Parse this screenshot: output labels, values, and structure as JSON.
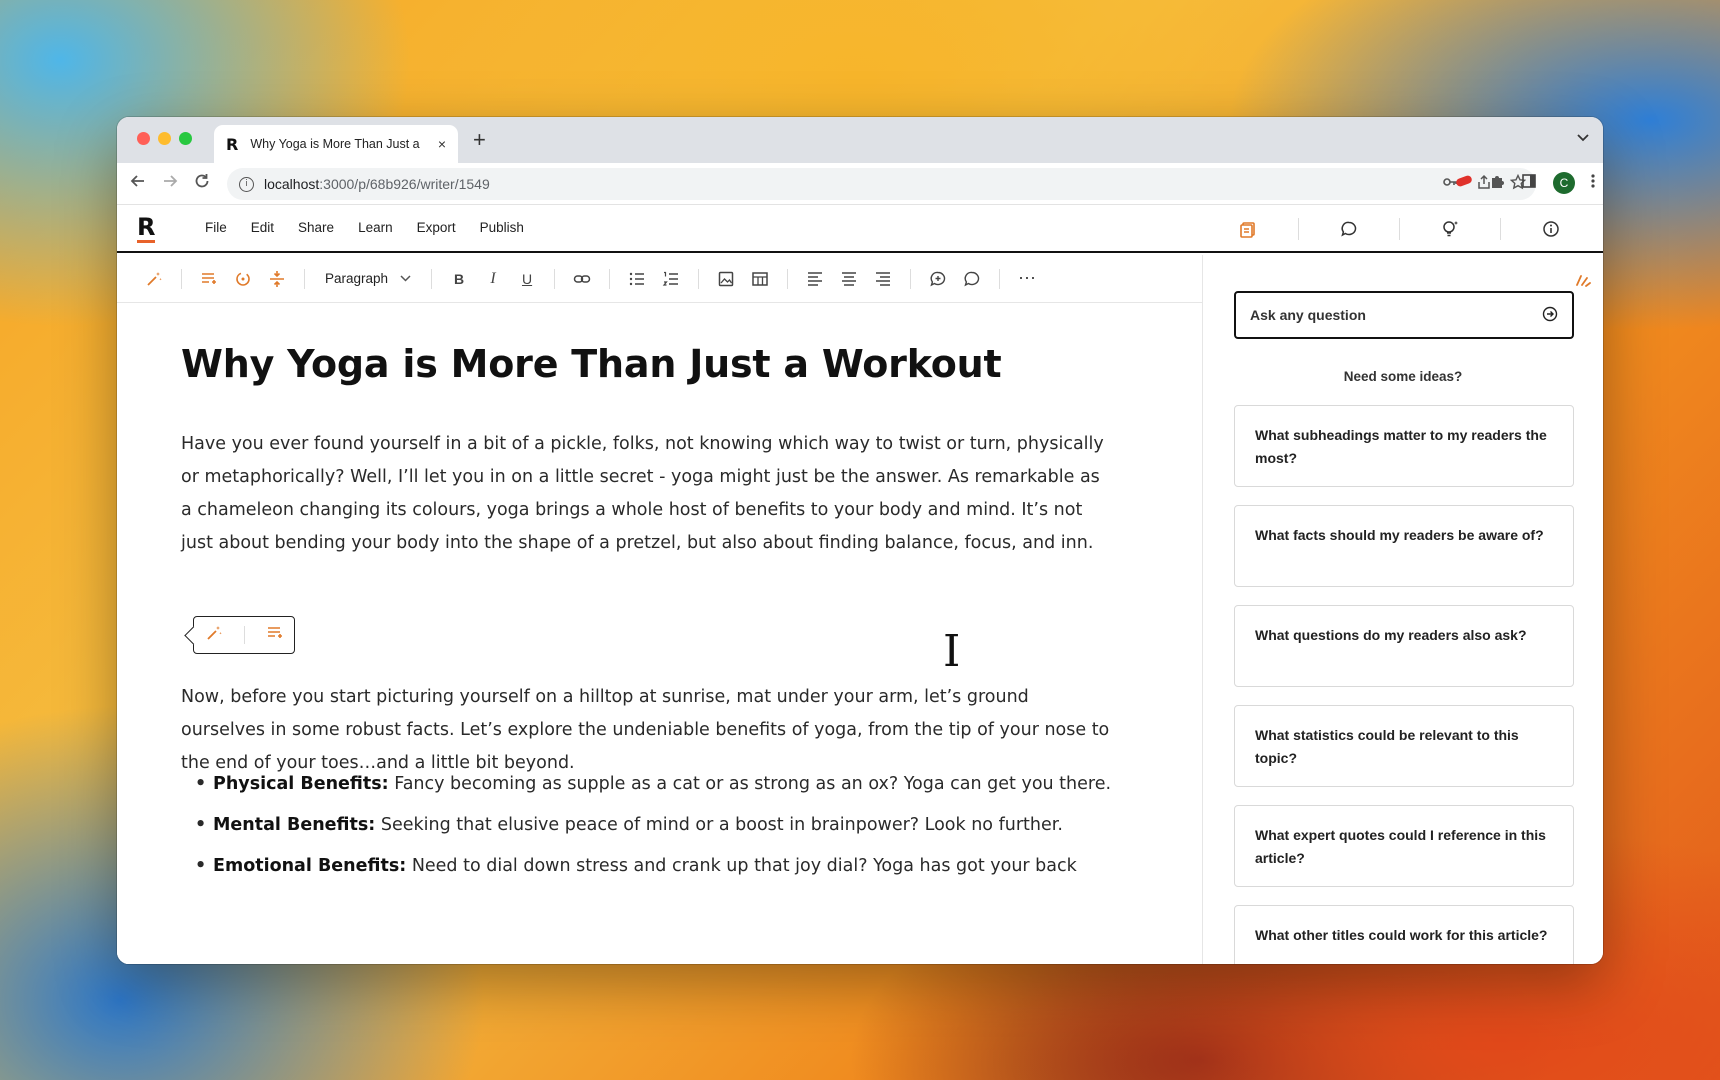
{
  "browser": {
    "tab_favicon": "R",
    "tab_title": "Why Yoga is More Than Just a",
    "tab_close": "×",
    "new_tab": "+",
    "url_host": "localhost",
    "url_path": ":3000/p/68b926/writer/1549",
    "avatar_letter": "C"
  },
  "app": {
    "logo": "R",
    "menu": [
      "File",
      "Edit",
      "Share",
      "Learn",
      "Export",
      "Publish"
    ],
    "accent_color": "#e07a2a"
  },
  "editor_toolbar": {
    "block_type": "Paragraph",
    "bold": "B",
    "italic": "I",
    "underline": "U",
    "more": "⋯"
  },
  "document": {
    "title": "Why Yoga is More Than Just a Workout",
    "paragraph_1": "Have you ever found yourself in a bit of a pickle, folks, not knowing which way to twist or turn, physically or metaphorically? Well, I’ll let you in on a little secret - yoga might just be the answer. As remarkable as a chameleon changing its colours, yoga brings a whole host of benefits to your body and mind. It’s not just about bending your body into the shape of a pretzel, but also about finding balance, focus, and inn.",
    "paragraph_2": "Now, before you start picturing yourself on a hilltop at sunrise, mat under your arm, let’s ground ourselves in some robust facts. Let’s explore the undeniable benefits of yoga, from the tip of your nose to the end of your toes…and a little bit beyond.",
    "bullets": [
      {
        "label": "Physical Benefits:",
        "text": " Fancy becoming as supple as a cat or as strong as an ox? Yoga can get you there."
      },
      {
        "label": "Mental Benefits:",
        "text": " Seeking that elusive peace of mind or a boost in brainpower? Look no further."
      },
      {
        "label": "Emotional Benefits:",
        "text": " Need to dial down stress and crank up that joy dial? Yoga has got your back"
      }
    ]
  },
  "assistant": {
    "ask_placeholder": "Ask any question",
    "ideas_heading": "Need some ideas?",
    "ideas": [
      "What subheadings matter to my readers the most?",
      "What facts should my readers be aware of?",
      "What questions do my readers also ask?",
      "What statistics could be relevant to this topic?",
      "What expert quotes could I reference in this article?",
      "What other titles could work for this article?"
    ]
  }
}
